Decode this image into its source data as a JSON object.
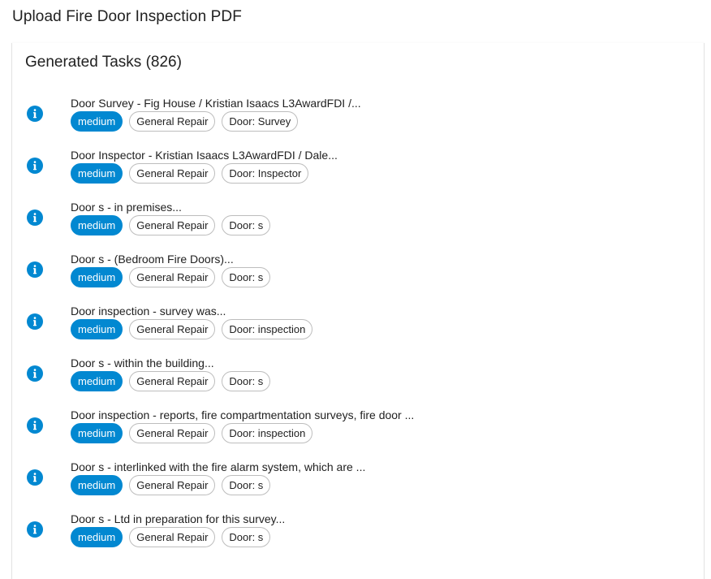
{
  "page": {
    "title": "Upload Fire Door Inspection PDF"
  },
  "card": {
    "title": "Generated Tasks (826)"
  },
  "colors": {
    "priority_chip": "#0288d1",
    "info_icon": "#0288d1",
    "chip_border": "#bdbdbd"
  },
  "icons": {
    "task_status": "info-icon"
  },
  "tasks": [
    {
      "title": "Door Survey - Fig House / Kristian Isaacs L3AwardFDI /...",
      "priority": "medium",
      "category": "General Repair",
      "door": "Door: Survey"
    },
    {
      "title": "Door Inspector - Kristian Isaacs L3AwardFDI / Dale...",
      "priority": "medium",
      "category": "General Repair",
      "door": "Door: Inspector"
    },
    {
      "title": "Door s - in premises...",
      "priority": "medium",
      "category": "General Repair",
      "door": "Door: s"
    },
    {
      "title": "Door s - (Bedroom Fire Doors)...",
      "priority": "medium",
      "category": "General Repair",
      "door": "Door: s"
    },
    {
      "title": "Door inspection - survey was...",
      "priority": "medium",
      "category": "General Repair",
      "door": "Door: inspection"
    },
    {
      "title": "Door s - within the building...",
      "priority": "medium",
      "category": "General Repair",
      "door": "Door: s"
    },
    {
      "title": "Door inspection - reports, fire compartmentation surveys, fire door ...",
      "priority": "medium",
      "category": "General Repair",
      "door": "Door: inspection"
    },
    {
      "title": "Door s - interlinked with the fire alarm system, which are ...",
      "priority": "medium",
      "category": "General Repair",
      "door": "Door: s"
    },
    {
      "title": "Door s - Ltd in preparation for this survey...",
      "priority": "medium",
      "category": "General Repair",
      "door": "Door: s"
    }
  ]
}
